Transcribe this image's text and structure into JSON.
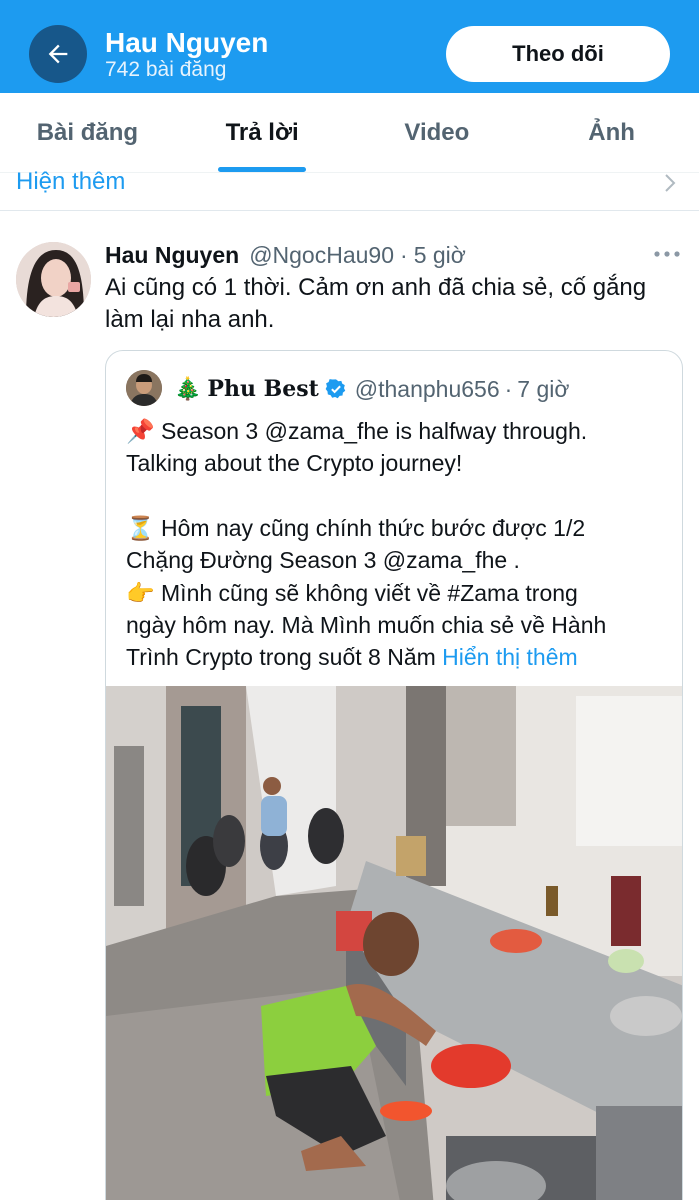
{
  "header": {
    "name": "Hau Nguyen",
    "post_count": "742 bài đăng",
    "follow_label": "Theo dõi",
    "accent": "#1d9bf0",
    "back_button_color": "#17578a",
    "back_icon": "arrow-left-icon"
  },
  "tabs": [
    {
      "label": "Bài đăng",
      "active": false
    },
    {
      "label": "Trả lời",
      "active": true
    },
    {
      "label": "Video",
      "active": false
    },
    {
      "label": "Ảnh",
      "active": false
    }
  ],
  "show_more": {
    "label": "Hiện thêm",
    "icon": "chevron-right-icon"
  },
  "tweet": {
    "author": "Hau Nguyen",
    "handle": "@NgocHau90",
    "separator": "·",
    "time": "5 giờ",
    "text": "Ai cũng có 1 thời. Cảm ơn anh đã chia sẻ, cố gắng làm lại nha anh.",
    "more_icon": "more-horizontal-icon"
  },
  "quote": {
    "emoji": "🎄",
    "author": "Phu Best",
    "verified_icon": "verified-badge-icon",
    "handle": "@thanphu656",
    "separator": "·",
    "time": "7 giờ",
    "lines": {
      "l1": "📌 Season 3 @zama_fhe  is halfway through.",
      "l2": "Talking about the Crypto journey!",
      "l3": "⏳ Hôm nay cũng chính thức bước được 1/2",
      "l4": "Chặng Đường Season 3 @zama_fhe .",
      "l5": "👉 Mình cũng sẽ không viết về #Zama trong",
      "l6": "ngày hôm nay. Mà Mình muốn chia sẻ về Hành",
      "l7": "Trình Crypto trong suốt 8 Năm "
    },
    "show_more_label": "Hiển thị thêm"
  }
}
